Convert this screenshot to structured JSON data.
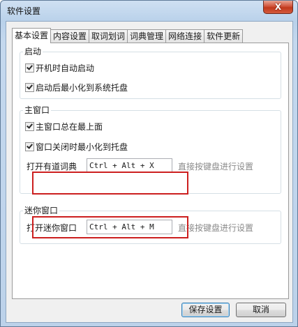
{
  "window": {
    "title": "软件设置",
    "close_label": "X"
  },
  "tabs": [
    {
      "label": "基本设置",
      "active": true
    },
    {
      "label": "内容设置"
    },
    {
      "label": "取词划词"
    },
    {
      "label": "词典管理"
    },
    {
      "label": "网络连接"
    },
    {
      "label": "软件更新"
    }
  ],
  "startup": {
    "title": "启动",
    "auto_start": {
      "label": "开机时自动启动",
      "checked": true
    },
    "minimize_tray": {
      "label": "启动后最小化到系统托盘",
      "checked": true
    }
  },
  "main_window": {
    "title": "主窗口",
    "always_on_top": {
      "label": "主窗口总在最上面",
      "checked": true
    },
    "close_to_tray": {
      "label": "窗口关闭时最小化到托盘",
      "checked": true
    },
    "hotkey": {
      "label": "打开有道词典",
      "value": "Ctrl + Alt + X",
      "hint": "直接按键盘进行设置"
    }
  },
  "mini_window": {
    "title": "迷你窗口",
    "hotkey": {
      "label": "打开迷你窗口",
      "value": "Ctrl + Alt + M",
      "hint": "直接按键盘进行设置"
    }
  },
  "footer": {
    "save_label": "保存设置",
    "cancel_label": "取消"
  },
  "colors": {
    "highlight_border": "#cc1f1f",
    "hint_text": "#8a8a8a"
  }
}
